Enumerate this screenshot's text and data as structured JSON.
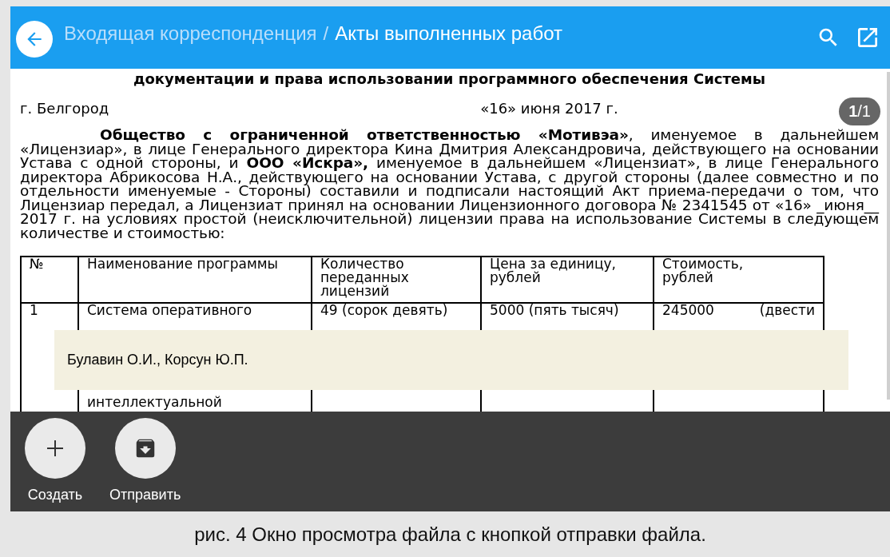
{
  "header": {
    "breadcrumb_parent": "Входящая корреспонденция",
    "separator": "/",
    "title": "Акты выполненных работ"
  },
  "document": {
    "heading": "документации и права использовании программного обеспечения Системы",
    "city": "г. Белгород",
    "date": "«16» июня 2017 г.",
    "page_indicator": "**1**/1",
    "paragraph": "**Общество с ограниченной ответственностью «Мотивэа»**, именуемое в дальнейшем «Лицензиар», в лице Генерального директора Кина Дмитрия Александровича, действующего на основании Устава с одной стороны, и **ООО «Искра»,** именуемое в дальнейшем «Лицензиат», в лице Генерального директора Абрикосова Н.А., действующего на основании Устава, с другой стороны (далее совместно и по отдельности именуемые - Стороны) составили и подписали настоящий Акт приема-передачи о том, что Лицензиар передал, а Лицензиат принял на основании Лицензионного договора № 2341545 от «16» _июня__ 2017 г. на условиях простой (неисключительной) лицензии права на использование Системы в следующем количестве и стоимостью:",
    "table": {
      "columns": [
        "№",
        "Наименование программы",
        "Количество переданных лицензий",
        "Цена за единицу, рублей",
        "Стоимость, рублей"
      ],
      "rows": [
        {
          "cells": [
            [
              "1"
            ],
            [
              "Система оперативного",
              "интеллектуальной"
            ],
            [
              "49 (сорок девять)"
            ],
            [
              "5000 (пять тысяч)"
            ],
            [
              "245000 (двести"
            ]
          ]
        }
      ]
    }
  },
  "note": "Булавин О.И., Корсун Ю.П.",
  "actions": [
    {
      "label": "Создать",
      "kind": "create"
    },
    {
      "label": "Отправить",
      "kind": "send"
    }
  ],
  "caption": "рис. 4 Окно просмотра файла с кнопкой отправки файла."
}
